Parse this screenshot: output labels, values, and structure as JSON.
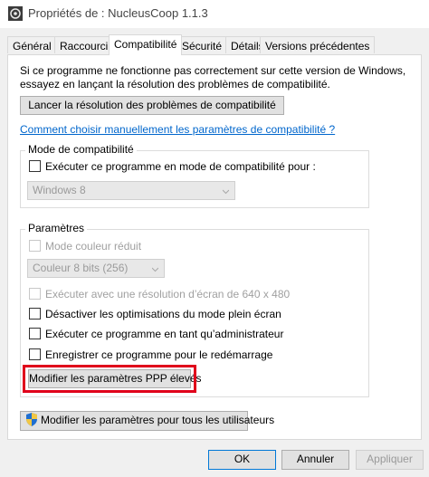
{
  "window": {
    "title": "Propriétés de : NucleusCoop 1.1.3"
  },
  "tabs": [
    {
      "label": "Général"
    },
    {
      "label": "Raccourci"
    },
    {
      "label": "Compatibilité"
    },
    {
      "label": "Sécurité"
    },
    {
      "label": "Détails"
    },
    {
      "label": "Versions précédentes"
    }
  ],
  "intro": {
    "line1": "Si ce programme ne fonctionne pas correctement sur cette version de Windows,",
    "line2": "essayez en lançant la résolution des problèmes de compatibilité."
  },
  "troubleshoot_button": "Lancer la résolution des problèmes de compatibilité",
  "manual_link": "Comment choisir manuellement les paramètres de compatibilité ?",
  "compat_mode": {
    "group_label": "Mode de compatibilité",
    "checkbox_label": "Exécuter ce programme en mode de compatibilité pour :",
    "os_select_value": "Windows 8"
  },
  "settings": {
    "group_label": "Paramètres",
    "reduced_color_label": "Mode couleur réduit",
    "color_select_value": "Couleur 8 bits (256)",
    "resolution_label": "Exécuter avec une résolution d’écran de 640 x 480",
    "fullscreen_label": "Désactiver les optimisations du mode plein écran",
    "admin_label": "Exécuter ce programme en tant qu’administrateur",
    "restart_label": "Enregistrer ce programme pour le redémarrage",
    "dpi_button": "Modifier les paramètres PPP élevés"
  },
  "all_users_button": "Modifier les paramètres pour tous les utilisateurs",
  "footer": {
    "ok": "OK",
    "cancel": "Annuler",
    "apply": "Appliquer"
  },
  "colors": {
    "highlight_border": "#e0001b",
    "link": "#0066cc"
  }
}
